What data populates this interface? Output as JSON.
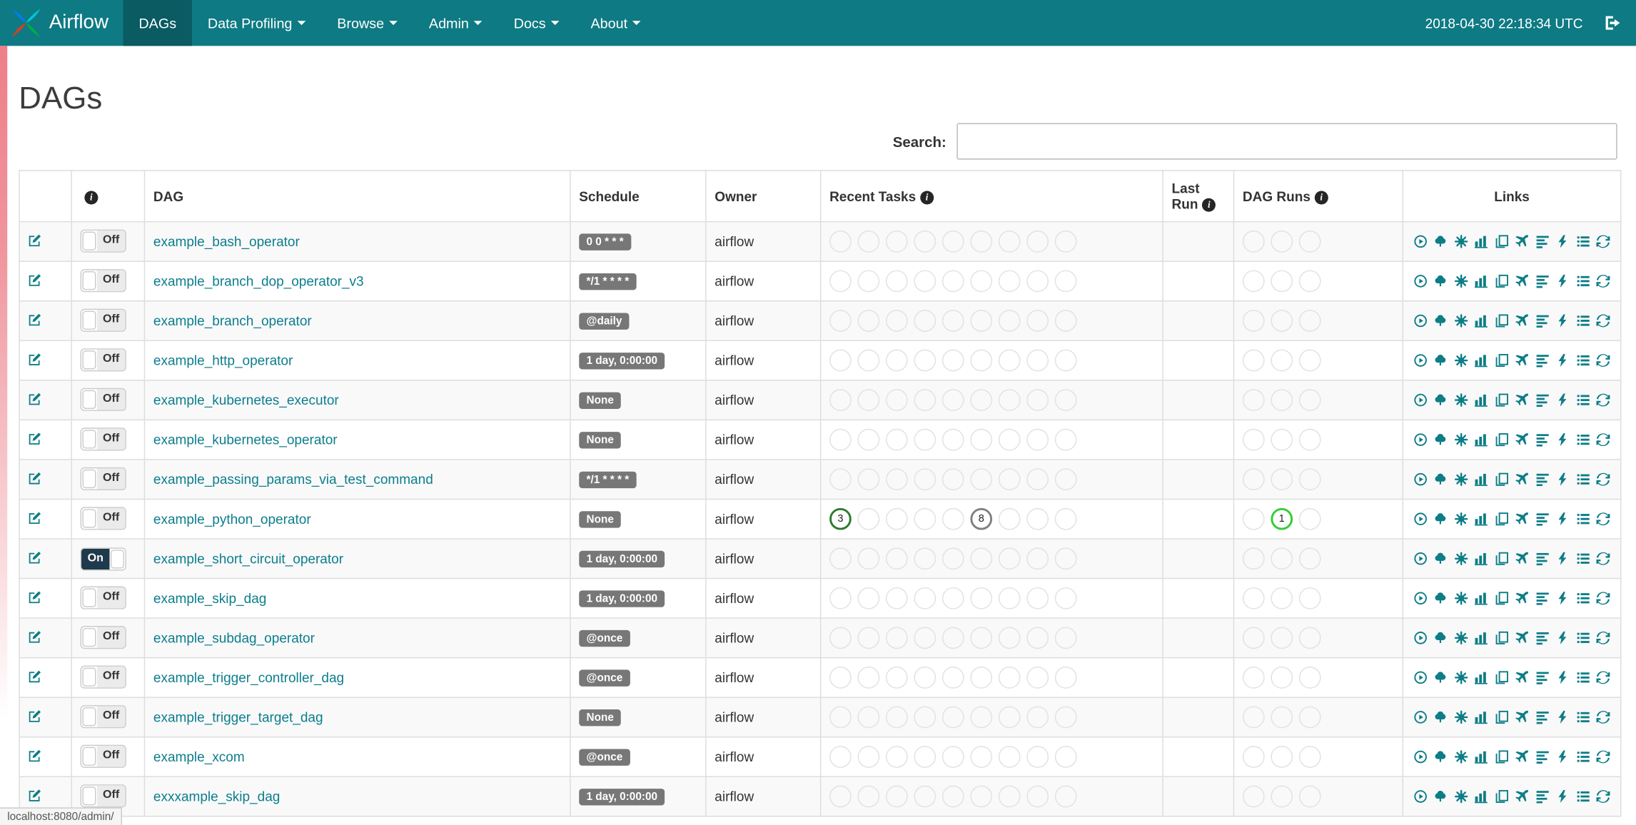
{
  "navbar": {
    "brand": "Airflow",
    "items": [
      {
        "label": "DAGs",
        "active": true,
        "dropdown": false
      },
      {
        "label": "Data Profiling",
        "active": false,
        "dropdown": true
      },
      {
        "label": "Browse",
        "active": false,
        "dropdown": true
      },
      {
        "label": "Admin",
        "active": false,
        "dropdown": true
      },
      {
        "label": "Docs",
        "active": false,
        "dropdown": true
      },
      {
        "label": "About",
        "active": false,
        "dropdown": true
      }
    ],
    "clock": "2018-04-30 22:18:34 UTC"
  },
  "page": {
    "title": "DAGs"
  },
  "search": {
    "label": "Search:",
    "value": ""
  },
  "table": {
    "headers": {
      "dag": "DAG",
      "schedule": "Schedule",
      "owner": "Owner",
      "recent_tasks": "Recent Tasks",
      "last_run": "Last Run",
      "dag_runs": "DAG Runs",
      "links": "Links"
    },
    "recent_task_slots": 9,
    "dag_run_slots": 3,
    "rows": [
      {
        "dag": "example_bash_operator",
        "toggle": "Off",
        "schedule": "0 0 * * *",
        "owner": "airflow",
        "last_run": "",
        "recent_tasks": [],
        "dag_runs": []
      },
      {
        "dag": "example_branch_dop_operator_v3",
        "toggle": "Off",
        "schedule": "*/1 * * * *",
        "owner": "airflow",
        "last_run": "",
        "recent_tasks": [],
        "dag_runs": []
      },
      {
        "dag": "example_branch_operator",
        "toggle": "Off",
        "schedule": "@daily",
        "owner": "airflow",
        "last_run": "",
        "recent_tasks": [],
        "dag_runs": []
      },
      {
        "dag": "example_http_operator",
        "toggle": "Off",
        "schedule": "1 day, 0:00:00",
        "owner": "airflow",
        "last_run": "",
        "recent_tasks": [],
        "dag_runs": []
      },
      {
        "dag": "example_kubernetes_executor",
        "toggle": "Off",
        "schedule": "None",
        "owner": "airflow",
        "last_run": "",
        "recent_tasks": [],
        "dag_runs": []
      },
      {
        "dag": "example_kubernetes_operator",
        "toggle": "Off",
        "schedule": "None",
        "owner": "airflow",
        "last_run": "",
        "recent_tasks": [],
        "dag_runs": []
      },
      {
        "dag": "example_passing_params_via_test_command",
        "toggle": "Off",
        "schedule": "*/1 * * * *",
        "owner": "airflow",
        "last_run": "",
        "recent_tasks": [],
        "dag_runs": []
      },
      {
        "dag": "example_python_operator",
        "toggle": "Off",
        "schedule": "None",
        "owner": "airflow",
        "last_run": "",
        "recent_tasks": [
          {
            "slot": 0,
            "count": "3",
            "color": "#2d7a2d"
          },
          {
            "slot": 5,
            "count": "8",
            "color": "#808080"
          }
        ],
        "dag_runs": [
          {
            "slot": 1,
            "count": "1",
            "color": "#32cd32"
          }
        ]
      },
      {
        "dag": "example_short_circuit_operator",
        "toggle": "On",
        "schedule": "1 day, 0:00:00",
        "owner": "airflow",
        "last_run": "",
        "recent_tasks": [],
        "dag_runs": []
      },
      {
        "dag": "example_skip_dag",
        "toggle": "Off",
        "schedule": "1 day, 0:00:00",
        "owner": "airflow",
        "last_run": "",
        "recent_tasks": [],
        "dag_runs": []
      },
      {
        "dag": "example_subdag_operator",
        "toggle": "Off",
        "schedule": "@once",
        "owner": "airflow",
        "last_run": "",
        "recent_tasks": [],
        "dag_runs": []
      },
      {
        "dag": "example_trigger_controller_dag",
        "toggle": "Off",
        "schedule": "@once",
        "owner": "airflow",
        "last_run": "",
        "recent_tasks": [],
        "dag_runs": []
      },
      {
        "dag": "example_trigger_target_dag",
        "toggle": "Off",
        "schedule": "None",
        "owner": "airflow",
        "last_run": "",
        "recent_tasks": [],
        "dag_runs": []
      },
      {
        "dag": "example_xcom",
        "toggle": "Off",
        "schedule": "@once",
        "owner": "airflow",
        "last_run": "",
        "recent_tasks": [],
        "dag_runs": []
      },
      {
        "dag": "exxxample_skip_dag",
        "toggle": "Off",
        "schedule": "1 day, 0:00:00",
        "owner": "airflow",
        "last_run": "",
        "recent_tasks": [],
        "dag_runs": []
      }
    ]
  },
  "link_icons": [
    {
      "name": "trigger-dag-icon",
      "icon": "play-circle"
    },
    {
      "name": "tree-view-icon",
      "icon": "tree"
    },
    {
      "name": "graph-view-icon",
      "icon": "graph"
    },
    {
      "name": "task-duration-icon",
      "icon": "stats"
    },
    {
      "name": "task-tries-icon",
      "icon": "duplicate"
    },
    {
      "name": "landing-times-icon",
      "icon": "plane"
    },
    {
      "name": "gantt-view-icon",
      "icon": "gantt"
    },
    {
      "name": "code-view-icon",
      "icon": "flash"
    },
    {
      "name": "logs-icon",
      "icon": "list"
    },
    {
      "name": "refresh-icon",
      "icon": "refresh"
    }
  ],
  "status_bar": {
    "text": "localhost:8080/admin/"
  },
  "colors": {
    "navbar": "#0e7a83",
    "navbar_active": "#0a5b62",
    "link": "#0c7e8d",
    "icon": "#0d7d86",
    "badge_bg": "#777777",
    "toggle_on_bg": "#1e3a4c",
    "success_green": "#2d7a2d",
    "running_green": "#32cd32",
    "queued_gray": "#808080"
  }
}
